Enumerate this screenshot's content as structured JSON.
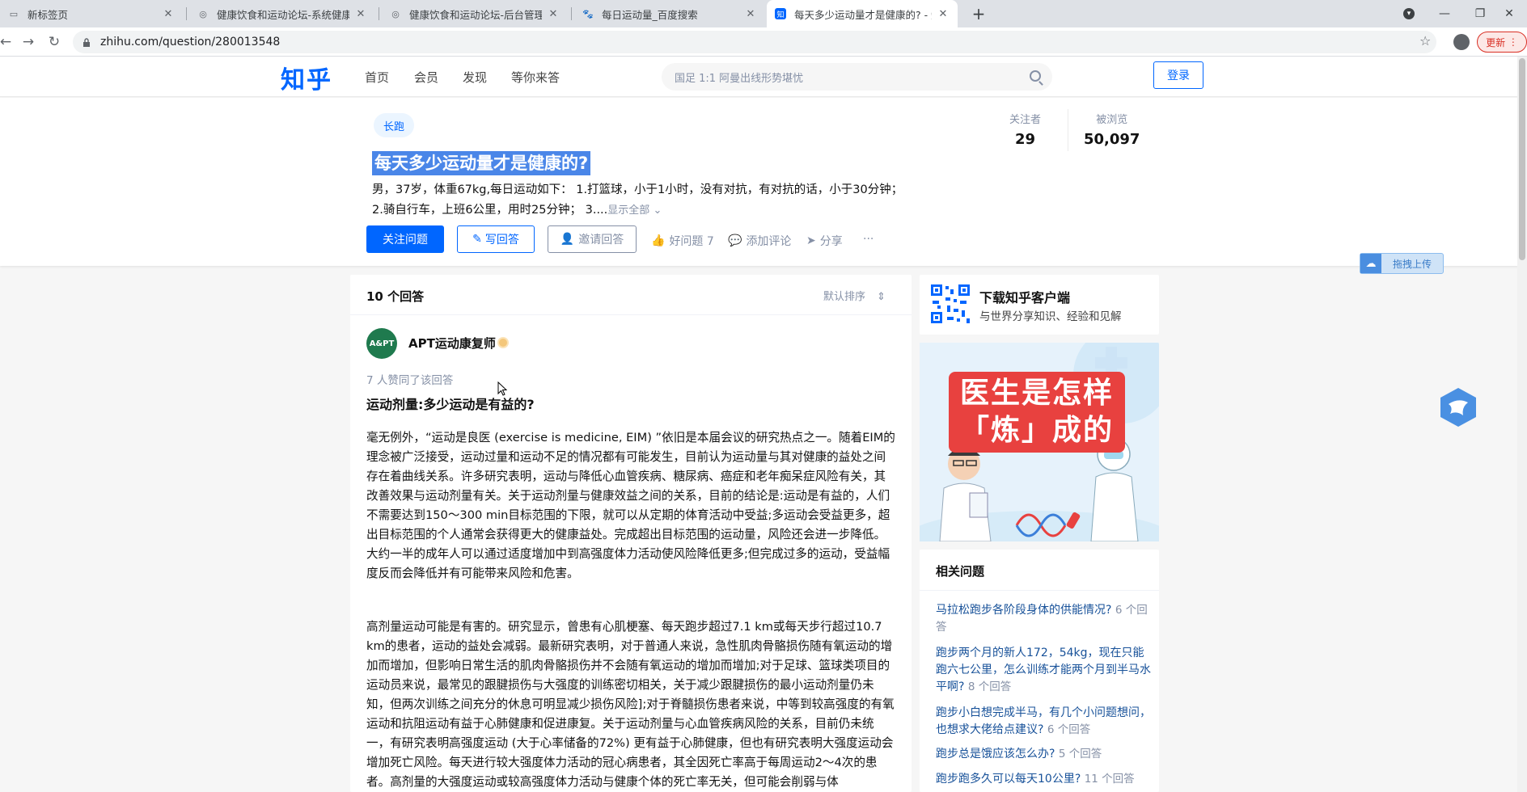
{
  "browser": {
    "tabs": [
      {
        "title": "新标签页"
      },
      {
        "title": "健康饮食和运动论坛-系统健康饮"
      },
      {
        "title": "健康饮食和运动论坛-后台管理系"
      },
      {
        "title": "每日运动量_百度搜索"
      },
      {
        "title": "每天多少运动量才是健康的? - 知"
      }
    ],
    "url": "zhihu.com/question/280013548",
    "update_label": "更新"
  },
  "header": {
    "logo": "知乎",
    "nav": [
      "首页",
      "会员",
      "发现",
      "等你来答"
    ],
    "search_placeholder": "国足 1:1 阿曼出线形势堪忧",
    "login_label": "登录"
  },
  "question": {
    "topic": "长跑",
    "title": "每天多少运动量才是健康的?",
    "detail_line1": "男，37岁，体重67kg,每日运动如下： 1.打篮球，小于1小时，没有对抗，有对抗的话，小于30分钟；",
    "detail_line2": "2.骑自行车，上班6公里，用时25分钟； 3....",
    "show_all": "显示全部",
    "followers_label": "关注者",
    "followers": "29",
    "views_label": "被浏览",
    "views": "50,097",
    "follow_btn": "关注问题",
    "write_btn": "写回答",
    "invite_btn": "邀请回答",
    "good_question": "好问题 7",
    "add_comment": "添加评论",
    "share": "分享",
    "more": "···"
  },
  "upload_widget": {
    "label": "拖拽上传"
  },
  "answers": {
    "count_label": "10 个回答",
    "sort_label": "默认排序",
    "author": "APT运动康复师",
    "avatar_text": "A&PT",
    "likes_note": "7 人赞同了该回答",
    "subtitle": "运动剂量:多少运动是有益的?",
    "para1": "毫无例外，“运动是良医 (exercise is medicine, EIM) ”依旧是本届会议的研究热点之一。随着EIM的理念被广泛接受，运动过量和运动不足的情况都有可能发生，目前认为运动量与其对健康的益处之间存在着曲线关系。许多研究表明，运动与降低心血管疾病、糖尿病、癌症和老年痴呆症风险有关，其改善效果与运动剂量有关。关于运动剂量与健康效益之间的关系，目前的结论是:运动是有益的，人们不需要达到150～300 min目标范围的下限，就可以从定期的体育活动中受益;多运动会受益更多，超出目标范围的个人通常会获得更大的健康益处。完成超出目标范围的运动量，风险还会进一步降低。大约一半的成年人可以通过适度增加中到高强度体力活动使风险降低更多;但完成过多的运动，受益幅度反而会降低并有可能带来风险和危害。",
    "para2": "高剂量运动可能是有害的。研究显示，曾患有心肌梗塞、每天跑步超过7.1 km或每天步行超过10.7 km的患者，运动的益处会减弱。最新研究表明，对于普通人来说，急性肌肉骨骼损伤随有氧运动的增加而增加，但影响日常生活的肌肉骨骼损伤并不会随有氧运动的增加而增加;对于足球、篮球类项目的运动员来说，最常见的跟腱损伤与大强度的训练密切相关，关于减少跟腱损伤的最小运动剂量仍未知，但两次训练之间充分的休息可明显减少损伤风险];对于脊髓损伤患者来说，中等到较高强度的有氧运动和抗阻运动有益于心肺健康和促进康复。关于运动剂量与心血管疾病风险的关系，目前仍未统一，有研究表明高强度运动 (大于心率储备的72%) 更有益于心肺健康，但也有研究表明大强度运动会增加死亡风险。每天进行较大强度体力活动的冠心病患者，其全因死亡率高于每周运动2～4次的患者。高剂量的大强度运动或较高强度体力活动与健康个体的死亡率无关，但可能会削弱与体"
  },
  "sidebar": {
    "download_title": "下载知乎客户端",
    "download_sub": "与世界分享知识、经验和见解",
    "ad_line1": "医生是怎样",
    "ad_line2": "「炼」成的",
    "related_title": "相关问题",
    "related": [
      {
        "q": "马拉松跑步各阶段身体的供能情况?",
        "c": "6 个回答"
      },
      {
        "q": "跑步两个月的新人172，54kg，现在只能跑六七公里，怎么训练才能两个月到半马水平啊?",
        "c": "8 个回答"
      },
      {
        "q": "跑步小白想完成半马，有几个小问题想问，也想求大佬给点建议?",
        "c": "6 个回答"
      },
      {
        "q": "跑步总是饿应该怎么办?",
        "c": "5 个回答"
      },
      {
        "q": "跑步跑多久可以每天10公里?",
        "c": "11 个回答"
      }
    ]
  },
  "colors": {
    "brand": "#0066ff",
    "link": "#175199",
    "muted": "#8590a6"
  }
}
